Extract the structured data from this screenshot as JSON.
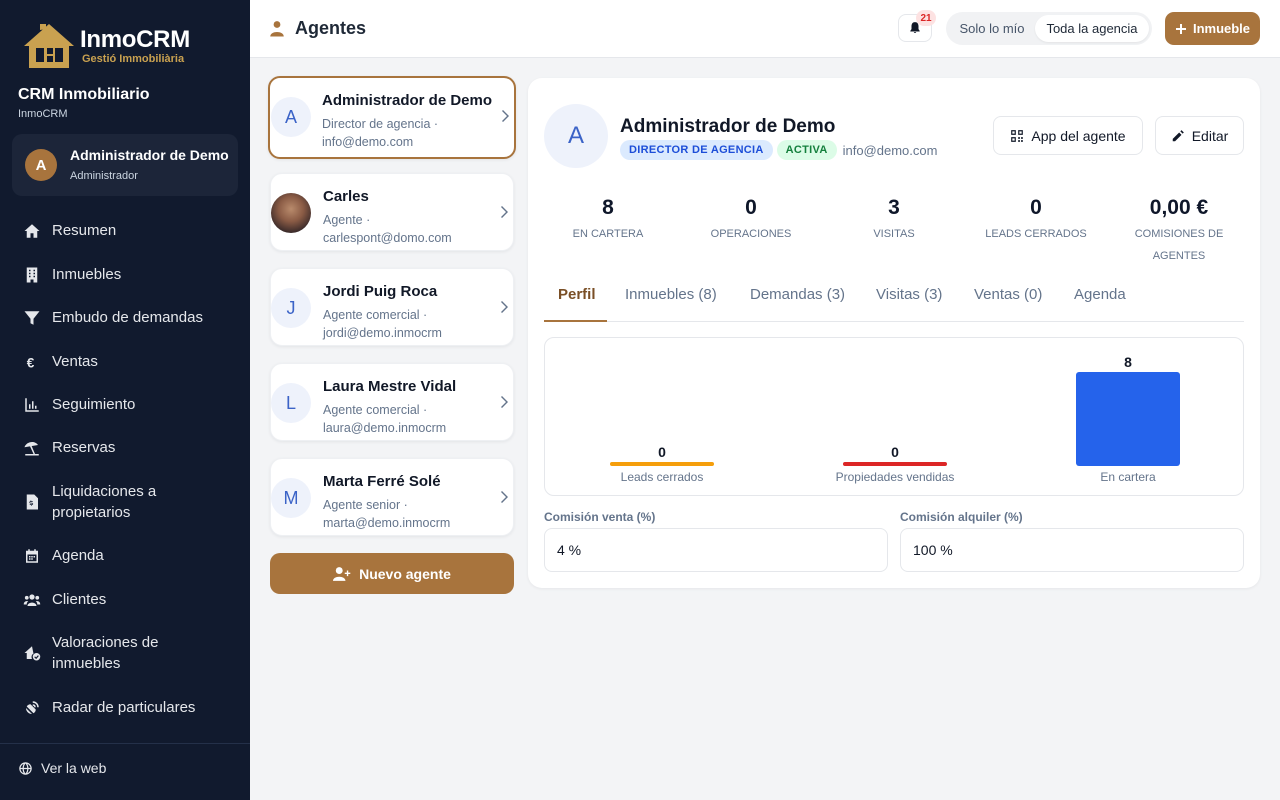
{
  "brand": {
    "title": "InmoCRM",
    "subtitle": "Gestió Immobiliària",
    "gold": "#c9a150"
  },
  "org": {
    "name": "CRM Inmobiliario",
    "sub": "InmoCRM"
  },
  "current_user": {
    "initial": "A",
    "name": "Administrador de Demo",
    "role": "Administrador"
  },
  "nav": [
    {
      "label": "Resumen",
      "icon": "home-icon"
    },
    {
      "label": "Inmuebles",
      "icon": "building-icon"
    },
    {
      "label": "Embudo de demandas",
      "icon": "funnel-icon"
    },
    {
      "label": "Ventas",
      "icon": "euro-icon"
    },
    {
      "label": "Seguimiento",
      "icon": "bar-chart-icon"
    },
    {
      "label": "Reservas",
      "icon": "umbrella-icon"
    },
    {
      "label": "Liquidaciones a propietarios",
      "icon": "invoice-icon"
    },
    {
      "label": "Agenda",
      "icon": "calendar-icon"
    },
    {
      "label": "Clientes",
      "icon": "users-icon"
    },
    {
      "label": "Valoraciones de inmuebles",
      "icon": "house-check-icon"
    },
    {
      "label": "Radar de particulares",
      "icon": "satellite-icon"
    }
  ],
  "footer": {
    "web_link": "Ver la web"
  },
  "header": {
    "title": "Agentes",
    "notifications": "21",
    "scope_options": [
      "Solo lo mío",
      "Toda la agencia"
    ],
    "scope_selected": "Toda la agencia",
    "add_button": "Inmueble"
  },
  "agents": [
    {
      "initial": "A",
      "name": "Administrador de Demo",
      "role": "Director de agencia ·",
      "email": "info@demo.com",
      "photo": false
    },
    {
      "initial": "",
      "name": "Carles",
      "role": "Agente ·",
      "email": "carlespont@domo.com",
      "photo": true
    },
    {
      "initial": "J",
      "name": "Jordi Puig Roca",
      "role": "Agente comercial ·",
      "email": "jordi@demo.inmocrm",
      "photo": false
    },
    {
      "initial": "L",
      "name": "Laura Mestre Vidal",
      "role": "Agente comercial ·",
      "email": "laura@demo.inmocrm",
      "photo": false
    },
    {
      "initial": "M",
      "name": "Marta Ferré Solé",
      "role": "Agente senior ·",
      "email": "marta@demo.inmocrm",
      "photo": false
    }
  ],
  "new_agent_button": "Nuevo agente",
  "detail": {
    "initial": "A",
    "name": "Administrador de Demo",
    "role_badge": "DIRECTOR DE AGENCIA",
    "status_badge": "ACTIVA",
    "email": "info@demo.com",
    "app_button": "App del agente",
    "edit_button": "Editar",
    "stats": [
      {
        "value": "8",
        "label": "EN CARTERA"
      },
      {
        "value": "0",
        "label": "OPERACIONES"
      },
      {
        "value": "3",
        "label": "VISITAS"
      },
      {
        "value": "0",
        "label": "LEADS CERRADOS"
      },
      {
        "value": "0,00 €",
        "label": "COMISIONES DE AGENTES"
      }
    ],
    "tabs": [
      "Perfil",
      "Inmuebles (8)",
      "Demandas (3)",
      "Visitas (3)",
      "Ventas (0)",
      "Agenda"
    ],
    "active_tab": "Perfil",
    "commission_sale_label": "Comisión venta (%)",
    "commission_sale_value": "4 %",
    "commission_rent_label": "Comisión alquiler (%)",
    "commission_rent_value": "100 %"
  },
  "chart_data": {
    "type": "bar",
    "categories": [
      "Leads cerrados",
      "Propiedades vendidas",
      "En cartera"
    ],
    "values": [
      0,
      0,
      8
    ],
    "colors": [
      "#f59e0b",
      "#dc2626",
      "#2563eb"
    ],
    "title": "",
    "xlabel": "",
    "ylabel": "",
    "grid": false,
    "data_labels": true
  },
  "colors": {
    "accent": "#a8743d",
    "sidebar": "#111a2e",
    "primary_blue": "#2563eb"
  }
}
